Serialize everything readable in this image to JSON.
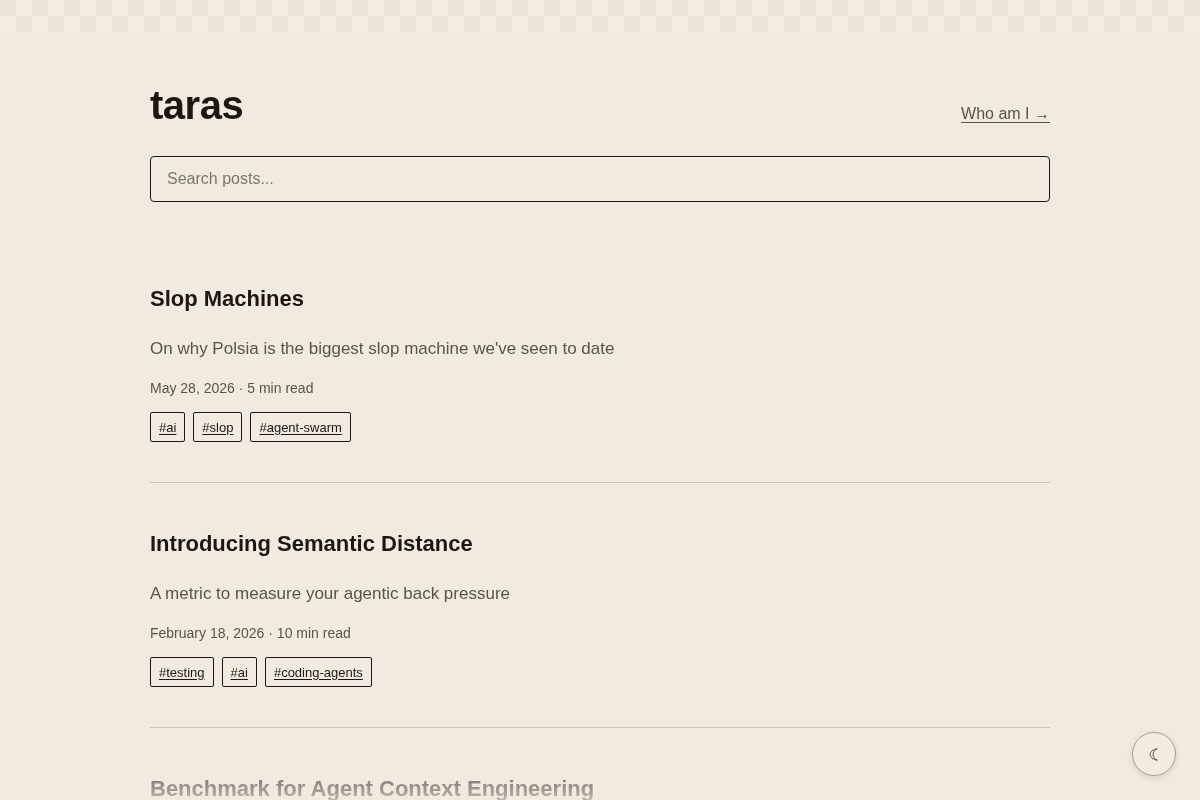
{
  "site": {
    "title": "taras",
    "about_link": "Who am I →"
  },
  "search": {
    "placeholder": "Search posts..."
  },
  "posts": [
    {
      "title": "Slop Machines",
      "description": "On why Polsia is the biggest slop machine we've seen to date",
      "meta": "May 28, 2026 · 5 min read",
      "tags": [
        "#ai",
        "#slop",
        "#agent-swarm"
      ]
    },
    {
      "title": "Introducing Semantic Distance",
      "description": "A metric to measure your agentic back pressure",
      "meta": "February 18, 2026 · 10 min read",
      "tags": [
        "#testing",
        "#ai",
        "#coding-agents"
      ]
    },
    {
      "title": "Benchmark for Agent Context Engineering"
    }
  ]
}
